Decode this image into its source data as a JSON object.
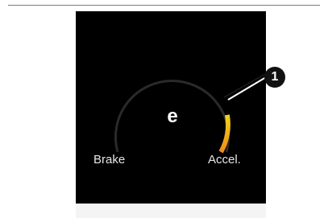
{
  "gauge": {
    "left_label": "Brake",
    "right_label": "Accel.",
    "center_glyph": "e",
    "center_icon": "eco-mode-icon",
    "accel_level_fraction": 0.33,
    "arc_color": "#2a2a2a",
    "accel_color_top": "#f2d41a",
    "accel_color_bottom": "#f08a1a"
  },
  "callout": {
    "number": "1"
  },
  "colors": {
    "screen_background": "#000000",
    "label_text": "#e6e6e6",
    "callout_background": "#111111"
  }
}
